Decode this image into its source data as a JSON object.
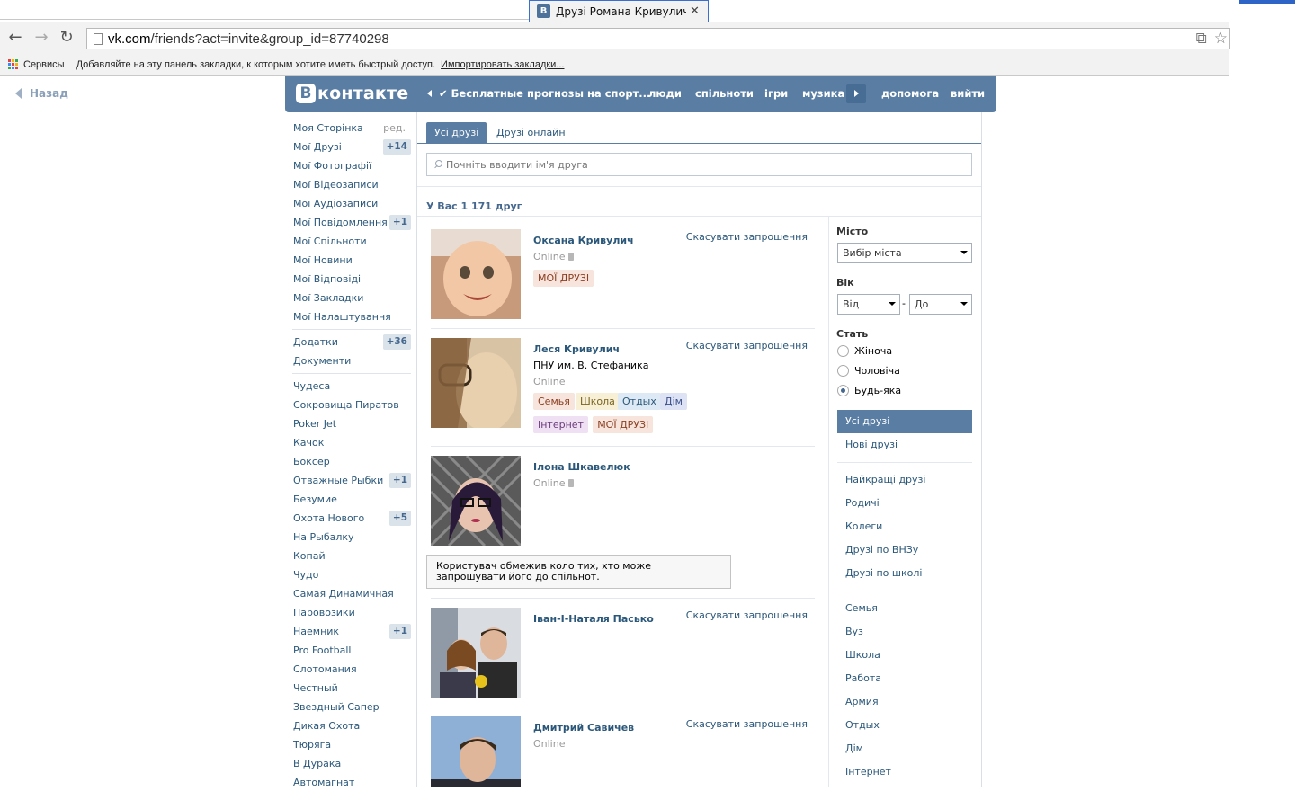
{
  "browser": {
    "tab_icon": "В",
    "tab_title": "Друзі Романа Кривулича | ",
    "url_host": "vk.com",
    "url_path": "/friends?act=invite&group_id=87740298",
    "bookmarks_services": "Сервисы",
    "bookmarks_hint": "Добавляйте на эту панель закладки, к которым хотите иметь быстрый доступ.",
    "bookmarks_import": "Импортировать закладки...",
    "apps_colors": [
      "#e0443e",
      "#f2b50f",
      "#35a853",
      "#4285f4",
      "#e0443e",
      "#f2b50f",
      "#35a853",
      "#4285f4",
      "#e0443e"
    ]
  },
  "back_label": "Назад",
  "header": {
    "logo_b": "В",
    "logo_word": "контакте",
    "promo": "✔ Бесплатные прогнозы на спорт...",
    "nav": [
      "люди",
      "спільноти",
      "ігри",
      "музика"
    ],
    "help": "допомога",
    "logout": "вийти",
    "color": "#597da3"
  },
  "left_menu": {
    "edit_label": "ред.",
    "main": [
      {
        "label": "Моя Сторінка",
        "count": ""
      },
      {
        "label": "Мої Друзі",
        "count": "+14"
      },
      {
        "label": "Мої Фотографії",
        "count": ""
      },
      {
        "label": "Мої Відеозаписи",
        "count": ""
      },
      {
        "label": "Мої Аудіозаписи",
        "count": ""
      },
      {
        "label": "Мої Повідомлення",
        "count": "+1"
      },
      {
        "label": "Мої Спільноти",
        "count": ""
      },
      {
        "label": "Мої Новини",
        "count": ""
      },
      {
        "label": "Мої Відповіді",
        "count": ""
      },
      {
        "label": "Мої Закладки",
        "count": ""
      },
      {
        "label": "Мої Налаштування",
        "count": ""
      }
    ],
    "apps": [
      {
        "label": "Додатки",
        "count": "+36"
      },
      {
        "label": "Документи",
        "count": ""
      }
    ],
    "games": [
      {
        "label": "Чудеса",
        "count": ""
      },
      {
        "label": "Сокровища Пиратов",
        "count": ""
      },
      {
        "label": "Poker Jet",
        "count": ""
      },
      {
        "label": "Качок",
        "count": ""
      },
      {
        "label": "Боксёр",
        "count": ""
      },
      {
        "label": "Отважные Рыбки",
        "count": "+1"
      },
      {
        "label": "Безумие",
        "count": ""
      },
      {
        "label": "Охота Нового",
        "count": "+5"
      },
      {
        "label": "На Рыбалку",
        "count": ""
      },
      {
        "label": "Копай",
        "count": ""
      },
      {
        "label": "Чудо",
        "count": ""
      },
      {
        "label": "Самая Динамичная",
        "count": ""
      },
      {
        "label": "Паровозики",
        "count": ""
      },
      {
        "label": "Наемник",
        "count": "+1"
      },
      {
        "label": "Pro Football",
        "count": ""
      },
      {
        "label": "Слотомания",
        "count": ""
      },
      {
        "label": "Честный",
        "count": ""
      },
      {
        "label": "Звездный Сапер",
        "count": ""
      },
      {
        "label": "Дикая Охота",
        "count": ""
      },
      {
        "label": "Тюряга",
        "count": ""
      },
      {
        "label": "В Дурака",
        "count": ""
      },
      {
        "label": "Автомагнат",
        "count": ""
      }
    ]
  },
  "tabs": {
    "all": "Усі друзі",
    "online": "Друзі онлайн"
  },
  "search": {
    "placeholder": "Почніть вводити ім'я друга"
  },
  "friends_count": "У Вас 1 171 друг",
  "cancel_label": "Скасувати запрошення",
  "friends": [
    {
      "name": "Оксана Кривулич",
      "uni": "",
      "status": "Online",
      "mobile": true,
      "cancel": true,
      "tags": [
        {
          "text": "МОЇ ДРУЗІ",
          "bg": "#f7e4dc",
          "fg": "#8b3f22"
        }
      ]
    },
    {
      "name": "Леся Кривулич",
      "uni": "ПНУ им. В. Стефаника",
      "status": "Online",
      "mobile": false,
      "cancel": true,
      "tags": [
        {
          "text": "Семья",
          "bg": "#f7e4dc",
          "fg": "#8b3f22"
        },
        {
          "text": "Школа",
          "bg": "#f7efd6",
          "fg": "#7a6420"
        },
        {
          "text": "Отдых",
          "bg": "#dde9f4",
          "fg": "#2b587a"
        },
        {
          "text": "Дім",
          "bg": "#dde3f4",
          "fg": "#3b4f8a"
        },
        {
          "text": "Інтернет",
          "bg": "#efe0f3",
          "fg": "#6a3b7a"
        },
        {
          "text": "МОЇ ДРУЗІ",
          "bg": "#f7e4dc",
          "fg": "#8b3f22"
        }
      ]
    },
    {
      "name": "Ілона Шкавелюк",
      "uni": "",
      "status": "Online",
      "mobile": true,
      "cancel": false,
      "tags": [],
      "notice": "Користувач обмежив коло тих, хто може запрошувати його до спільнот."
    },
    {
      "name": "Іван-І-Наталя Пасько",
      "uni": "",
      "status": "",
      "mobile": false,
      "cancel": true,
      "tags": []
    },
    {
      "name": "Дмитрий Савичев",
      "uni": "",
      "status": "Online",
      "mobile": false,
      "cancel": true,
      "tags": []
    }
  ],
  "filters": {
    "city_label": "Місто",
    "city_select": "Вибір міста",
    "age_label": "Вік",
    "age_from": "Від",
    "age_to": "До",
    "age_dash": "-",
    "sex_label": "Стать",
    "sex_options": [
      "Жіноча",
      "Чоловіча",
      "Будь-яка"
    ],
    "sex_selected": "Будь-яка",
    "lists_main": [
      "Усі друзі",
      "Нові друзі"
    ],
    "lists_groups": [
      "Найкращі друзі",
      "Родичі",
      "Колеги",
      "Друзі по ВНЗу",
      "Друзі по школі"
    ],
    "lists_custom": [
      "Семья",
      "Вуз",
      "Школа",
      "Работа",
      "Армия",
      "Отдых",
      "Дім",
      "Інтернет"
    ]
  }
}
